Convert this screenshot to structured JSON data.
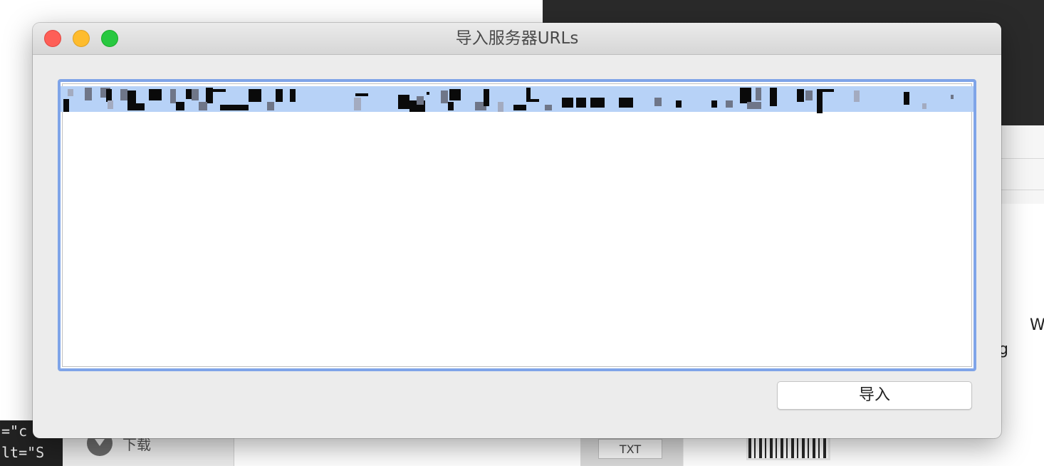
{
  "window": {
    "title": "导入服务器URLs"
  },
  "url_input": {
    "value": "",
    "content_note": "single line of selected text, redacted"
  },
  "buttons": {
    "import_label": "导入"
  },
  "background": {
    "code_line_1": "=\"c",
    "code_line_2": "lt=\"S",
    "sidebar_download_label": "下载",
    "txt_button_label": "TXT",
    "right_partial_text_1": "W",
    "right_partial_text_2": "g"
  },
  "colors": {
    "focus_ring": "#7fa4e8",
    "selection": "#b7d2f7",
    "close": "#fe5f57",
    "minimize": "#febc2e",
    "zoom": "#28c840"
  }
}
